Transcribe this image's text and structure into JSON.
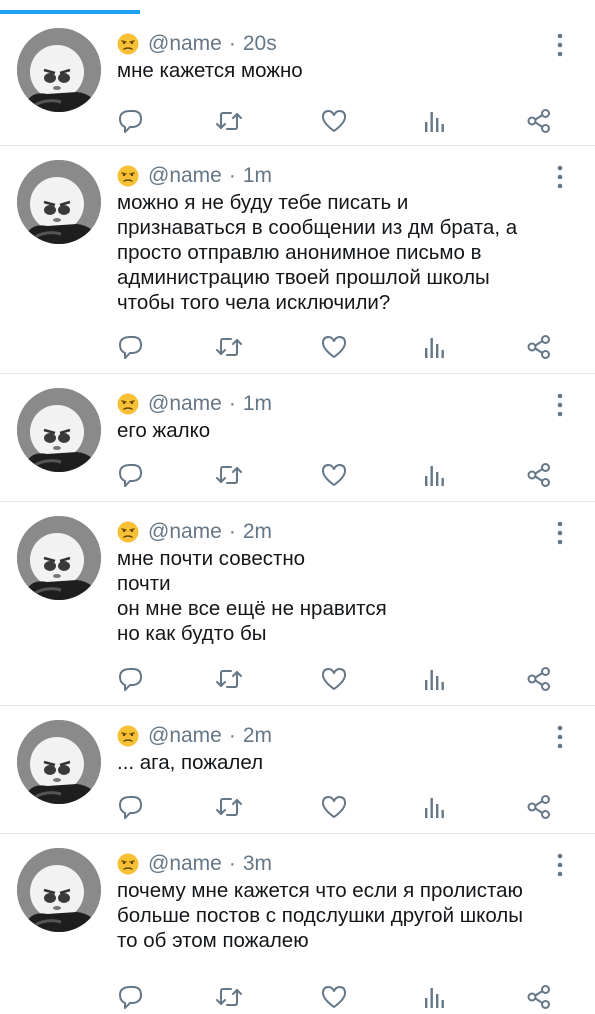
{
  "tweets": [
    {
      "handle": "@name",
      "time": "20s",
      "lines": [
        "мне кажется можно"
      ]
    },
    {
      "handle": "@name",
      "time": "1m",
      "lines": [
        "можно я не буду тебе писать и",
        "признаваться в сообщении из дм брата, а",
        "просто отправлю анонимное письмо в",
        "администрацию твоей прошлой школы",
        "чтобы того чела исключили?"
      ]
    },
    {
      "handle": "@name",
      "time": "1m",
      "lines": [
        "его жалко"
      ]
    },
    {
      "handle": "@name",
      "time": "2m",
      "lines": [
        "мне почти совестно",
        "почти",
        "он мне все ещё не нравится",
        "но как будто бы"
      ]
    },
    {
      "handle": "@name",
      "time": "2m",
      "lines": [
        "... ага, пожалел"
      ]
    },
    {
      "handle": "@name",
      "time": "3m",
      "lines": [
        "почему мне кажется что если я пролистаю",
        "больше постов с подслушки другой школы",
        "то об этом пожалею"
      ]
    }
  ],
  "meta": {
    "separator": "·",
    "emoji_icon": "unamused-face-emoji-icon",
    "action_icons": [
      "reply-icon",
      "retweet-icon",
      "like-icon",
      "analytics-icon",
      "share-icon"
    ],
    "accent_color": "#1da1f2",
    "icon_color": "#657786",
    "emoji_color": "#f7c136"
  }
}
